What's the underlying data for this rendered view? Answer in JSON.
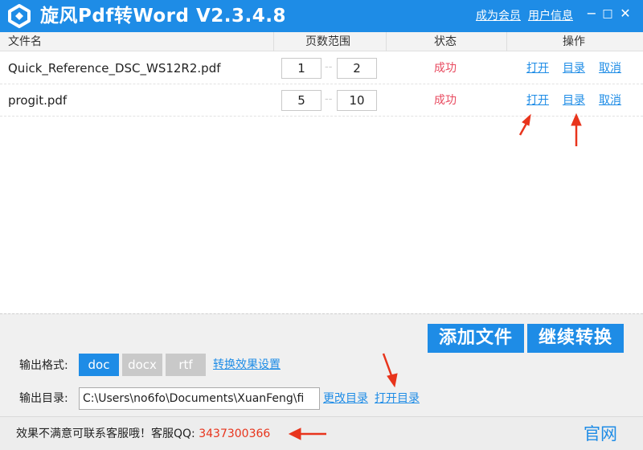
{
  "window": {
    "title": "旋风Pdf转Word  V2.3.4.8",
    "become_member": "成为会员",
    "user_info": "用户信息",
    "minimize_glyph": "−",
    "maximize_glyph": "□",
    "close_glyph": "✕"
  },
  "table": {
    "headers": {
      "filename": "文件名",
      "page_range": "页数范围",
      "status": "状态",
      "actions": "操作"
    },
    "rows": [
      {
        "filename": "Quick_Reference_DSC_WS12R2.pdf",
        "page_from": "1",
        "page_to": "2",
        "range_sep": "--",
        "status": "成功",
        "open": "打开",
        "directory": "目录",
        "cancel": "取消"
      },
      {
        "filename": "progit.pdf",
        "page_from": "5",
        "page_to": "10",
        "range_sep": "--",
        "status": "成功",
        "open": "打开",
        "directory": "目录",
        "cancel": "取消"
      }
    ]
  },
  "buttons": {
    "add_file": "添加文件",
    "continue_convert": "继续转换"
  },
  "output": {
    "format_label": "输出格式:",
    "formats": [
      "doc",
      "docx",
      "rtf"
    ],
    "selected_format": "doc",
    "settings_link": "转换效果设置",
    "dir_label": "输出目录:",
    "dir_value": "C:\\Users\\no6fo\\Documents\\XuanFeng\\fi",
    "change_dir": "更改目录",
    "open_dir": "打开目录"
  },
  "footer": {
    "message": "效果不满意可联系客服哦！客服QQ: ",
    "qq": "3437300366",
    "official_site": "官网"
  },
  "colors": {
    "accent": "#1E8CE6",
    "success": "#E84A5F",
    "annotation_red": "#E8341C",
    "disabled_gray": "#C9C9C9"
  }
}
